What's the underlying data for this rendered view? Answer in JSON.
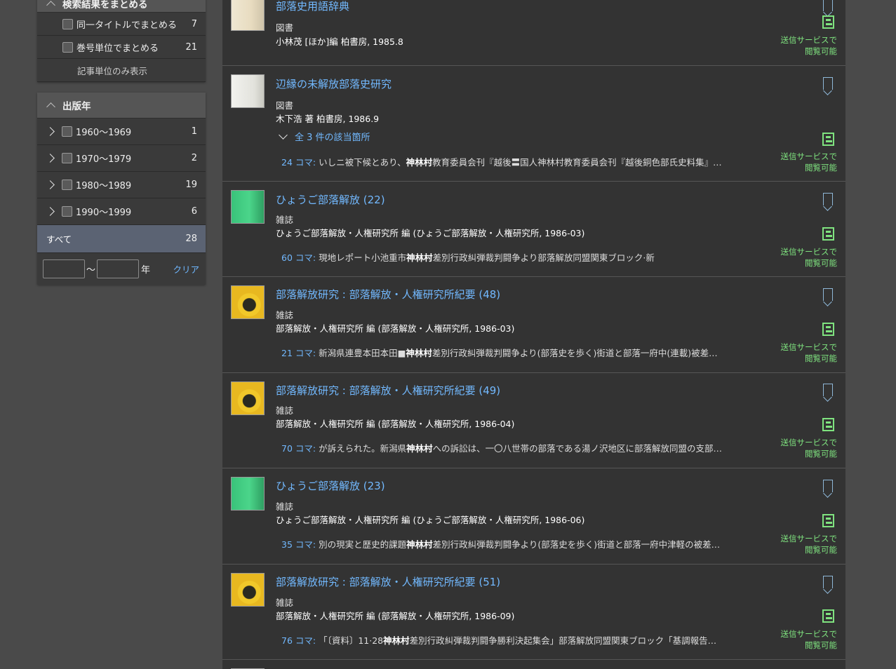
{
  "sidebar": {
    "group_header": "検索結果をまとめる",
    "group_items": [
      {
        "label": "同一タイトルでまとめる",
        "count": "7"
      },
      {
        "label": "巻号単位でまとめる",
        "count": "21"
      }
    ],
    "article_only_link": "記事単位のみ表示",
    "year_header": "出版年",
    "years": [
      {
        "label": "1960〜1969",
        "count": "1"
      },
      {
        "label": "1970〜1979",
        "count": "2"
      },
      {
        "label": "1980〜1989",
        "count": "19"
      },
      {
        "label": "1990〜1999",
        "count": "6"
      }
    ],
    "all": {
      "label": "すべて",
      "count": "28"
    },
    "range": {
      "tilde": "〜",
      "unit": "年",
      "clear": "クリア"
    }
  },
  "results": [
    {
      "title": "部落史用語辞典",
      "type": "図書",
      "author": "小林茂 [ほか]編 柏書房, 1985.8",
      "online": [
        "送信サービスで",
        "閲覧可能"
      ]
    },
    {
      "title": "辺縁の未解放部落史研究",
      "type": "図書",
      "author": "木下浩 著 柏書房, 1986.9",
      "expand": "全 3 件の該当箇所",
      "snippet": {
        "koma": "24 コマ:",
        "pre": "いしニ被下候とあり、",
        "hit": "神林村",
        "post": "教育委員会刊『越後〓国人神林村教育委員会刊『越後銅色部氏史料集』…"
      },
      "online": [
        "送信サービスで",
        "閲覧可能"
      ]
    },
    {
      "title": "ひょうご部落解放 (22)",
      "type": "雑誌",
      "author": "ひょうご部落解放・人権研究所 編 (ひょうご部落解放・人権研究所, 1986-03)",
      "snippet": {
        "koma": "60 コマ:",
        "pre": "現地レポート小池重市",
        "hit": "神林村",
        "post": "差別行政糾弾裁判闘争より部落解放同盟関東ブロック·新"
      },
      "online": [
        "送信サービスで",
        "閲覧可能"
      ]
    },
    {
      "title": "部落解放研究 : 部落解放・人権研究所紀要 (48)",
      "type": "雑誌",
      "author": "部落解放・人権研究所 編 (部落解放・人権研究所, 1986-03)",
      "snippet": {
        "koma": "21 コマ:",
        "pre": "新潟県連豊本田本田■",
        "hit": "神林村",
        "post": "差別行政糾弾裁判闘争より(部落史を歩く)街道と部落一府中(連載)被差…"
      },
      "online": [
        "送信サービスで",
        "閲覧可能"
      ]
    },
    {
      "title": "部落解放研究 : 部落解放・人権研究所紀要 (49)",
      "type": "雑誌",
      "author": "部落解放・人権研究所 編 (部落解放・人権研究所, 1986-04)",
      "snippet": {
        "koma": "70 コマ:",
        "pre": "が訴えられた。新潟県",
        "hit": "神林村",
        "post": "への訴訟は、一〇八世帯の部落である湯ノ沢地区に部落解放同盟の支部…"
      },
      "online": [
        "送信サービスで",
        "閲覧可能"
      ]
    },
    {
      "title": "ひょうご部落解放 (23)",
      "type": "雑誌",
      "author": "ひょうご部落解放・人権研究所 編 (ひょうご部落解放・人権研究所, 1986-06)",
      "snippet": {
        "koma": "35 コマ:",
        "pre": "別の現実と歴史的課題",
        "hit": "神林村",
        "post": "差別行政糾弾裁判闘争より(部落史を歩く)街道と部落一府中津軽の被差…"
      },
      "online": [
        "送信サービスで",
        "閲覧可能"
      ]
    },
    {
      "title": "部落解放研究 : 部落解放・人権研究所紀要 (51)",
      "type": "雑誌",
      "author": "部落解放・人権研究所 編 (部落解放・人権研究所, 1986-09)",
      "snippet": {
        "koma": "76 コマ:",
        "pre": "「〔資料〕11·28",
        "hit": "神林村",
        "post": "差別行政糾弾裁判闘争勝利決起集会」部落解放同盟関東ブロック「基調報告…"
      },
      "online": [
        "送信サービスで",
        "閲覧可能"
      ]
    }
  ]
}
